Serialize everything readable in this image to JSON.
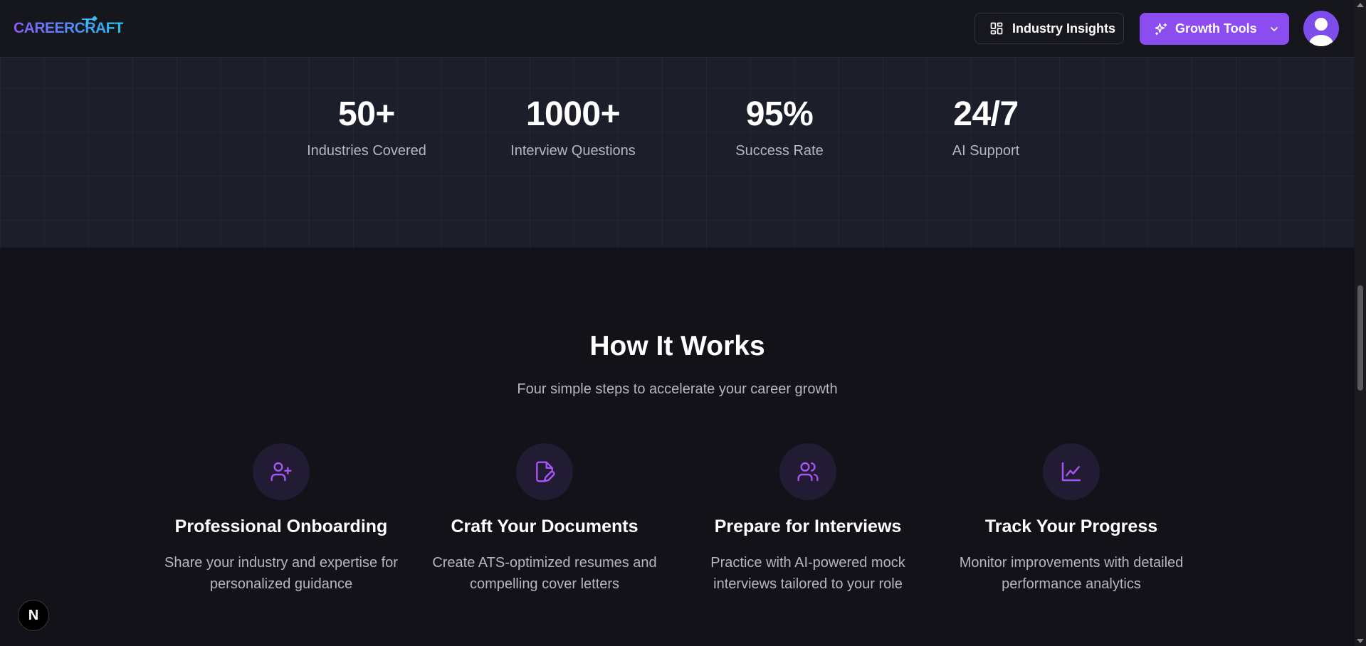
{
  "header": {
    "logo_text": "CAREERCRAFT",
    "insights_label": "Industry Insights",
    "growth_label": "Growth Tools"
  },
  "stats": [
    {
      "value": "50+",
      "label": "Industries Covered"
    },
    {
      "value": "1000+",
      "label": "Interview Questions"
    },
    {
      "value": "95%",
      "label": "Success Rate"
    },
    {
      "value": "24/7",
      "label": "AI Support"
    }
  ],
  "how": {
    "title": "How It Works",
    "subtitle": "Four simple steps to accelerate your career growth",
    "steps": [
      {
        "icon": "user-plus-icon",
        "title": "Professional Onboarding",
        "desc": "Share your industry and expertise for personalized guidance"
      },
      {
        "icon": "file-pen-icon",
        "title": "Craft Your Documents",
        "desc": "Create ATS-optimized resumes and compelling cover letters"
      },
      {
        "icon": "users-icon",
        "title": "Prepare for Interviews",
        "desc": "Practice with AI-powered mock interviews tailored to your role"
      },
      {
        "icon": "line-chart-icon",
        "title": "Track Your Progress",
        "desc": "Monitor improvements with detailed performance analytics"
      }
    ]
  },
  "next_badge": "N",
  "colors": {
    "accent": "#8b4cf0",
    "icon": "#a855f7",
    "background": "#121218",
    "stats_band": "#1c1e2a"
  }
}
